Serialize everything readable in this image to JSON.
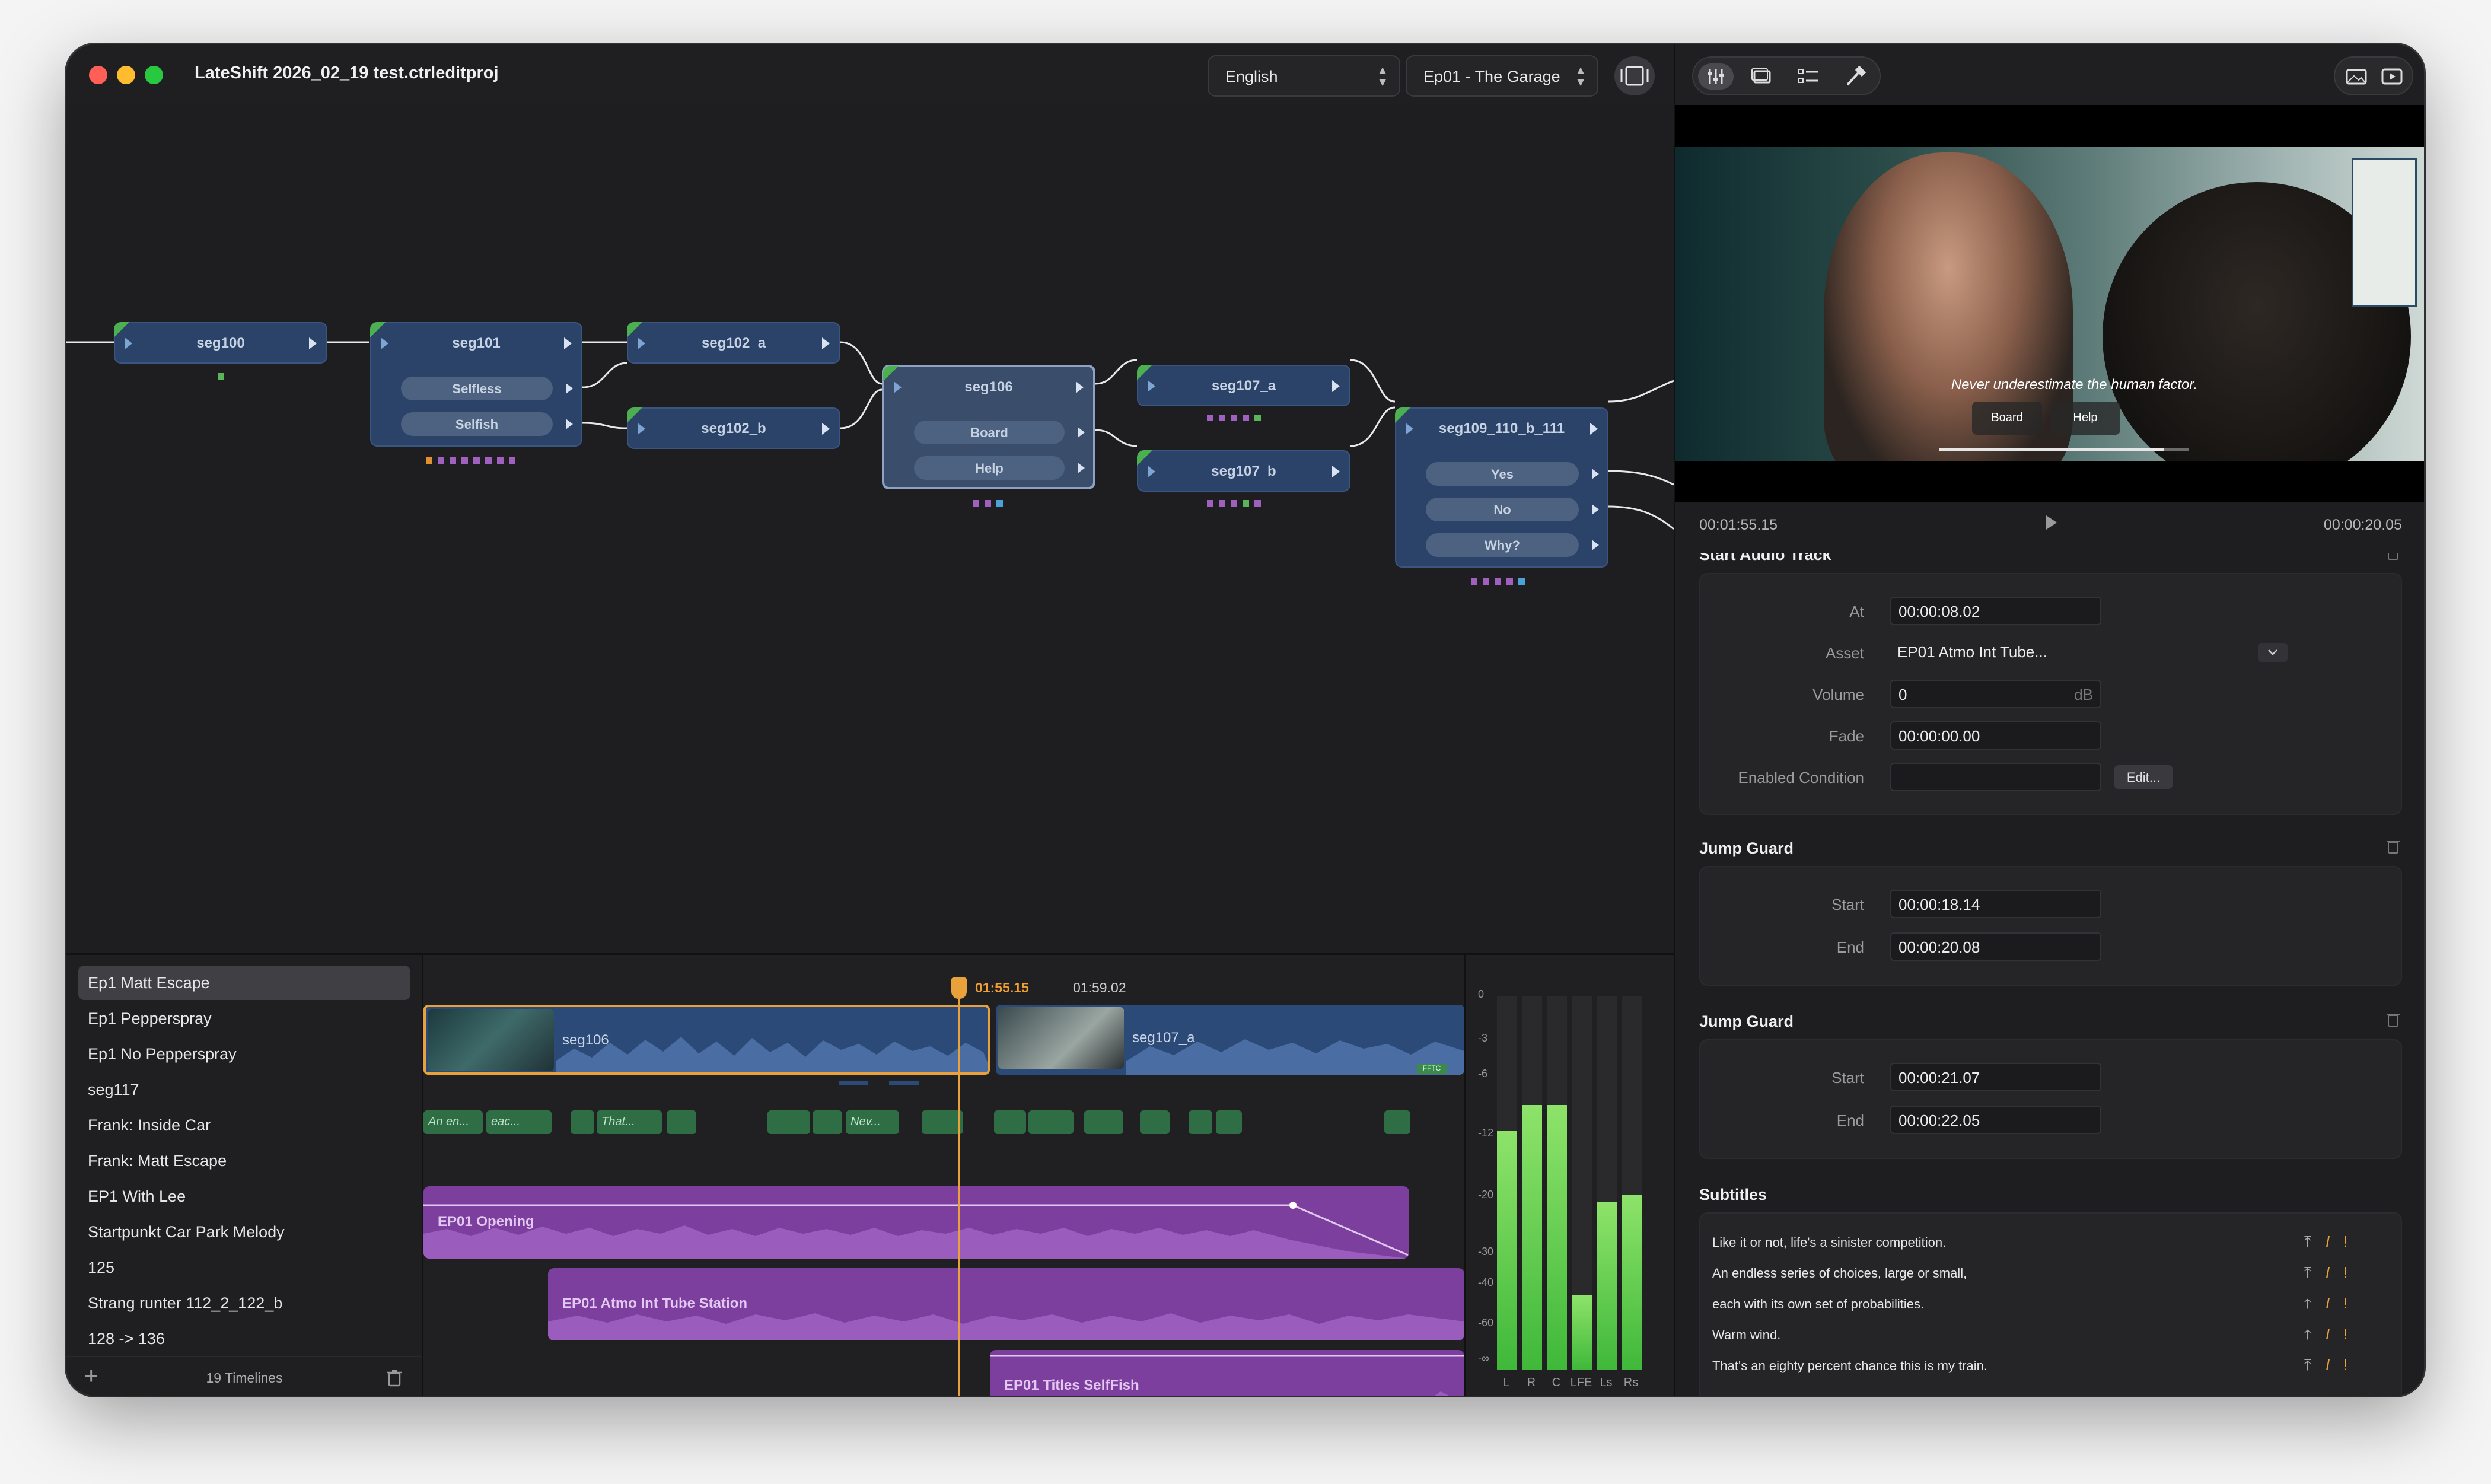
{
  "window": {
    "title": "LateShift 2026_02_19 test.ctrleditproj",
    "language_select": "English",
    "episode_select": "Ep01 - The Garage"
  },
  "colors": {
    "node_blue": "#2b4368",
    "accent_orange": "#e9a13b",
    "audio_purple": "#7d3f9e",
    "subtitle_green": "#2f6e45",
    "meter_green": "#4cc43a"
  },
  "graph": {
    "nodes": [
      {
        "id": "seg100",
        "label": "seg100",
        "choices": []
      },
      {
        "id": "seg101",
        "label": "seg101",
        "choices": [
          "Selfless",
          "Selfish"
        ]
      },
      {
        "id": "seg102_a",
        "label": "seg102_a",
        "choices": []
      },
      {
        "id": "seg102_b",
        "label": "seg102_b",
        "choices": []
      },
      {
        "id": "seg106",
        "label": "seg106",
        "choices": [
          "Board",
          "Help"
        ]
      },
      {
        "id": "seg107_a",
        "label": "seg107_a",
        "choices": []
      },
      {
        "id": "seg107_b",
        "label": "seg107_b",
        "choices": []
      },
      {
        "id": "seg109_110_b_111",
        "label": "seg109_110_b_111",
        "choices": [
          "Yes",
          "No",
          "Why?"
        ]
      }
    ]
  },
  "timelines": {
    "items": [
      "Ep1 Matt Escape",
      "Ep1 Pepperspray",
      "Ep1 No Pepperspray",
      "seg117",
      "Frank: Inside Car",
      "Frank: Matt Escape",
      "EP1 With Lee",
      "Startpunkt Car Park Melody",
      "125",
      "Strang runter 112_2_122_b",
      "128 -> 136"
    ],
    "active_index": 0,
    "count_label": "19 Timelines"
  },
  "editor": {
    "current_timecode": "01:55.15",
    "marker_timecode": "01:59.02",
    "video_clips": [
      "seg106",
      "seg107_a"
    ],
    "subtitle_chips": [
      "An en...",
      "eac...",
      "That...",
      "Nev..."
    ],
    "audio_clips": [
      "EP01 Opening",
      "EP01 Atmo Int Tube Station",
      "EP01 Titles SelfFish"
    ],
    "flag": "FFTC"
  },
  "meters": {
    "scale": [
      "0",
      "-3",
      "-6",
      "-12",
      "-20",
      "-30",
      "-40",
      "-60",
      "-∞"
    ],
    "channels": [
      "L",
      "R",
      "C",
      "LFE",
      "Ls",
      "Rs"
    ],
    "levels": [
      0.64,
      0.71,
      0.71,
      0.2,
      0.45,
      0.47
    ]
  },
  "preview": {
    "subtitle": "Never underestimate the human factor.",
    "buttons": [
      "Board",
      "Help"
    ],
    "progress": 0.9,
    "time_current": "00:01:55.15",
    "time_total": "00:00:20.05"
  },
  "inspector": {
    "start_audio": {
      "title": "Start Audio Track",
      "at_label": "At",
      "at": "00:00:08.02",
      "asset_label": "Asset",
      "asset": "EP01 Atmo Int Tube...",
      "volume_label": "Volume",
      "volume": "0",
      "volume_unit": "dB",
      "fade_label": "Fade",
      "fade": "00:00:00.00",
      "condition_label": "Enabled Condition",
      "condition": "",
      "edit_label": "Edit..."
    },
    "jump_guard_1": {
      "title": "Jump Guard",
      "start_label": "Start",
      "start": "00:00:18.14",
      "end_label": "End",
      "end": "00:00:20.08"
    },
    "jump_guard_2": {
      "title": "Jump Guard",
      "start_label": "Start",
      "start": "00:00:21.07",
      "end_label": "End",
      "end": "00:00:22.05"
    },
    "subtitles": {
      "title": "Subtitles",
      "lines": [
        "Like it or not, life's a sinister competition.",
        "An endless series of choices, large or small,",
        "each with its own set of probabilities.",
        "Warm wind.",
        "That's an eighty percent chance this is my train."
      ]
    }
  }
}
